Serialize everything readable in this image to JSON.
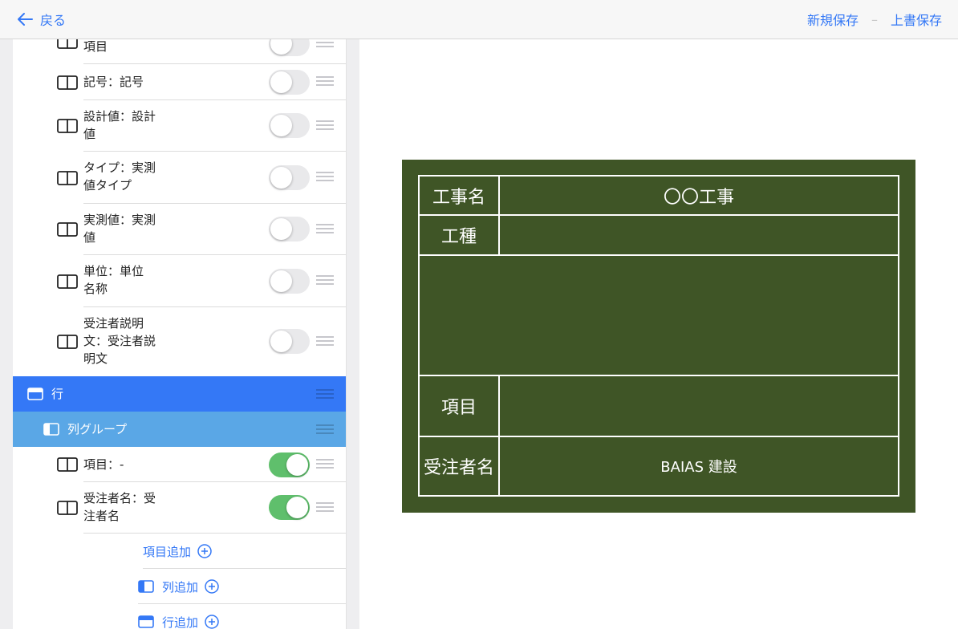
{
  "topbar": {
    "back_label": "戻る",
    "save_new_label": "新規保存",
    "separator": "–",
    "overwrite_label": "上書保存"
  },
  "list": {
    "partial_item_label": "項目",
    "items": [
      {
        "label": "記号：記号",
        "on": false
      },
      {
        "label": "設計値：設計\n値",
        "on": false
      },
      {
        "label": "タイプ：実測\n値タイプ",
        "on": false
      },
      {
        "label": "実測値：実測\n値",
        "on": false
      },
      {
        "label": "単位：単位\n名称",
        "on": false
      },
      {
        "label": "受注者説明\n文：受注者説\n明文",
        "on": false
      }
    ],
    "row_band_label": "行",
    "colgroup_band_label": "列グループ",
    "sub_items": [
      {
        "label": "項目：-",
        "on": true
      },
      {
        "label": "受注者名：受\n注者名",
        "on": true
      }
    ],
    "add_item_label": "項目追加",
    "add_column_label": "列追加",
    "add_row_label": "行追加"
  },
  "board": {
    "background": "#3f5526",
    "rows": [
      {
        "header": "工事名",
        "value": "〇〇工事"
      },
      {
        "header": "工種",
        "value": ""
      },
      {
        "header": "",
        "value": ""
      },
      {
        "header": "項目",
        "value": ""
      },
      {
        "header": "受注者名",
        "value": "BAIAS 建設"
      }
    ]
  },
  "colors": {
    "accent": "#3478f6",
    "row_band": "#3478f6",
    "colgroup_band": "#5aa7e6",
    "toggle_on": "#5fbf6c"
  },
  "icons": {
    "back": "arrow-left-icon",
    "column": "column-split-icon",
    "row": "row-icon",
    "column_group": "column-group-icon",
    "add": "plus-circle-icon",
    "drag": "drag-handle-icon"
  }
}
